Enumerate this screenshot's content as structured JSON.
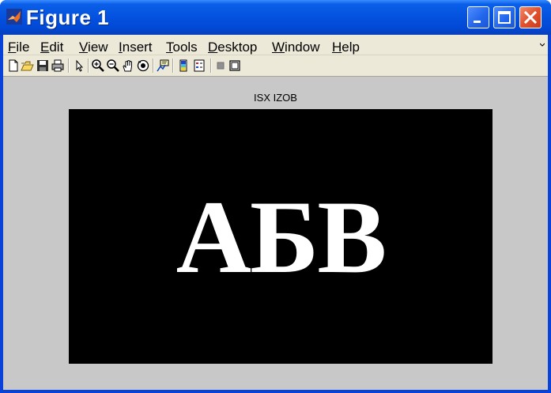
{
  "window": {
    "title": "Figure 1"
  },
  "menu": {
    "items": [
      {
        "underline": "F",
        "rest": "ile"
      },
      {
        "underline": "E",
        "rest": "dit"
      },
      {
        "underline": "V",
        "rest": "iew"
      },
      {
        "underline": "I",
        "rest": "nsert"
      },
      {
        "underline": "T",
        "rest": "ools"
      },
      {
        "underline": "D",
        "rest": "esktop"
      },
      {
        "underline": "W",
        "rest": "indow"
      },
      {
        "underline": "H",
        "rest": "elp"
      }
    ]
  },
  "toolbar": {
    "buttons": [
      "new-figure-icon",
      "open-file-icon",
      "save-icon",
      "print-icon",
      "edit-plot-arrow-icon",
      "zoom-in-icon",
      "zoom-out-icon",
      "pan-hand-icon",
      "rotate-3d-icon",
      "data-cursor-icon",
      "colorbar-icon",
      "legend-icon",
      "hide-plot-tools-icon",
      "show-plot-tools-icon"
    ]
  },
  "axes": {
    "title": "ISX IZOB"
  },
  "image": {
    "text": "АБВ",
    "background": "#000000",
    "foreground": "#ffffff"
  },
  "colors": {
    "titlebar": "#0553e0",
    "close_button": "#e0522f",
    "figure_background": "#c8c8c8",
    "menubar": "#ece9d8"
  }
}
